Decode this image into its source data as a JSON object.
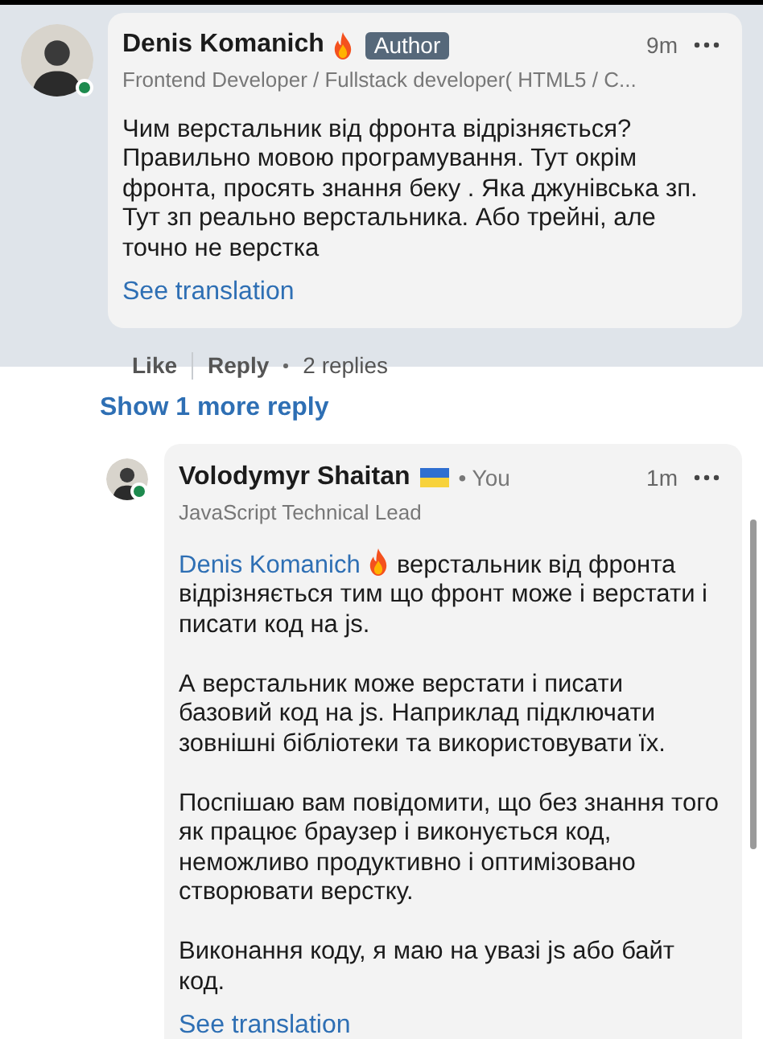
{
  "comment": {
    "author": "Denis Komanich",
    "badge": "Author",
    "time": "9m",
    "headline": "Frontend Developer / Fullstack developer( HTML5 / C...",
    "online": true,
    "paragraphs": [
      "Чим верстальник від фронта відрізняється? Правильно мовою програмування. Тут окрім фронта, просять знання беку . Яка джунівська зп. Тут зп реально верстальника. Або трейні, але точно не верстка"
    ],
    "translation": "See translation"
  },
  "actions": [
    {
      "label": "Like"
    },
    {
      "label": "Reply"
    }
  ],
  "replies_count": "2 replies",
  "show_more": "Show 1 more reply",
  "reply": {
    "author": "Volodymyr Shaitan",
    "you": "• You",
    "time": "1m",
    "headline": "JavaScript Technical Lead",
    "online": true,
    "mention": "Denis Komanich",
    "paragraphs": [
      "верстальник від фронта відрізняється тим що фронт може і верстати і писати код на js.",
      "А верстальник може верстати і писати базовий код на js. Наприклад підключати зовнішні бібліотеки та використовувати їх.",
      "Поспішаю вам повідомити, що без знання того як працює браузер і виконується код, неможливо продуктивно і оптимізовано створювати верстку.",
      "Виконання коду, я маю на увазі js або байт код."
    ],
    "translation": "See translation"
  }
}
